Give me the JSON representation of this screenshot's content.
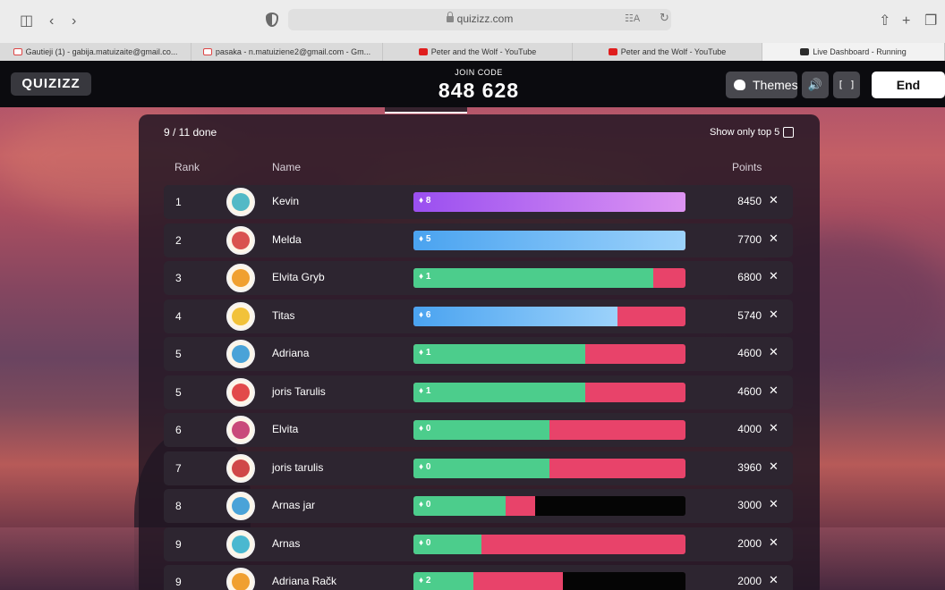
{
  "browser": {
    "url": "quizizz.com",
    "tabs": [
      {
        "title": "Gautieji (1) - gabija.matuizaite@gmail.co..."
      },
      {
        "title": "pasaka - n.matuiziene2@gmail.com - Gm..."
      },
      {
        "title": "Peter and the Wolf - YouTube"
      },
      {
        "title": "Peter and the Wolf - YouTube"
      },
      {
        "title": "Live Dashboard - Running"
      }
    ]
  },
  "header": {
    "logo": "QUIZIZZ",
    "join_label": "JOIN CODE",
    "join_code": "848 628",
    "themes_label": "Themes",
    "end_label": "End"
  },
  "leaderboard": {
    "progress": "9 / 11 done",
    "top5_label": "Show only top 5",
    "col_rank": "Rank",
    "col_name": "Name",
    "col_points": "Points",
    "rows": [
      {
        "rank": "1",
        "name": "Kevin",
        "streak": "8",
        "points": "8450",
        "color": "purple",
        "correct_fraction": 1.0,
        "answered_fraction": 1.0,
        "avatar_color": "#53b9c6"
      },
      {
        "rank": "2",
        "name": "Melda",
        "streak": "5",
        "points": "7700",
        "color": "blue",
        "correct_fraction": 1.0,
        "answered_fraction": 1.0,
        "avatar_color": "#d9534f"
      },
      {
        "rank": "3",
        "name": "Elvita Gryb",
        "streak": "1",
        "points": "6800",
        "color": "green",
        "correct_fraction": 0.88,
        "answered_fraction": 1.0,
        "avatar_color": "#f0a030"
      },
      {
        "rank": "4",
        "name": "Titas",
        "streak": "6",
        "points": "5740",
        "color": "blue",
        "correct_fraction": 0.75,
        "answered_fraction": 1.0,
        "avatar_color": "#f2c23a"
      },
      {
        "rank": "5",
        "name": "Adriana",
        "streak": "1",
        "points": "4600",
        "color": "green",
        "correct_fraction": 0.63,
        "answered_fraction": 1.0,
        "avatar_color": "#4aa3d8"
      },
      {
        "rank": "5",
        "name": "joris Tarulis",
        "streak": "1",
        "points": "4600",
        "color": "green",
        "correct_fraction": 0.63,
        "answered_fraction": 1.0,
        "avatar_color": "#e24a4a"
      },
      {
        "rank": "6",
        "name": "Elvita",
        "streak": "0",
        "points": "4000",
        "color": "green",
        "correct_fraction": 0.5,
        "answered_fraction": 1.0,
        "avatar_color": "#c94a7a"
      },
      {
        "rank": "7",
        "name": "joris tarulis",
        "streak": "0",
        "points": "3960",
        "color": "green",
        "correct_fraction": 0.5,
        "answered_fraction": 1.0,
        "avatar_color": "#d04848"
      },
      {
        "rank": "8",
        "name": "Arnas jar",
        "streak": "0",
        "points": "3000",
        "color": "green",
        "correct_fraction": 0.34,
        "answered_fraction": 0.45,
        "avatar_color": "#4aa3d8"
      },
      {
        "rank": "9",
        "name": "Arnas",
        "streak": "0",
        "points": "2000",
        "color": "green",
        "correct_fraction": 0.25,
        "answered_fraction": 1.0,
        "avatar_color": "#4ab8d0"
      },
      {
        "rank": "9",
        "name": "Adriana Rač̌k",
        "streak": "2",
        "points": "2000",
        "color": "green",
        "correct_fraction": 0.22,
        "answered_fraction": 0.55,
        "avatar_color": "#f0a030"
      }
    ]
  }
}
